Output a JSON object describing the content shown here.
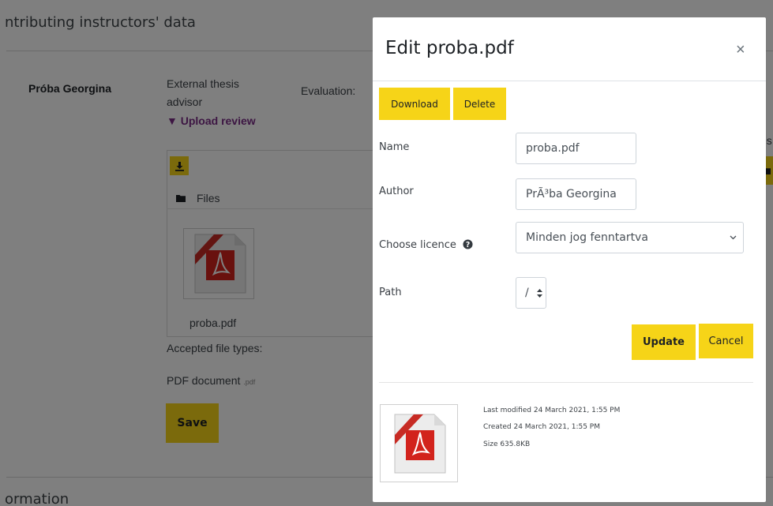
{
  "background": {
    "section_title": "ntributing instructors' data",
    "student_name": "Próba Georgina",
    "role_line1": "External thesis",
    "role_line2": "advisor",
    "upload_review": "▼ Upload review",
    "evaluation_label": "Evaluation:",
    "files_label": "Files",
    "file_name": "proba.pdf",
    "accepted_types_label": "Accepted file types:",
    "pdf_document_label": "PDF document",
    "pdf_ext": ".pdf",
    "save_label": "Save",
    "partial_right_label": "es:",
    "bottom_section_title": "ormation"
  },
  "modal": {
    "title": "Edit proba.pdf",
    "close_glyph": "×",
    "download_label": "Download",
    "delete_label": "Delete",
    "name_label": "Name",
    "name_value": "proba.pdf",
    "author_label": "Author",
    "author_value": "PrÃ³ba Georgina",
    "licence_label": "Choose licence",
    "licence_value": "Minden jog fenntartva",
    "path_label": "Path",
    "path_value": "/",
    "update_label": "Update",
    "cancel_label": "Cancel",
    "last_modified": "Last modified  24 March 2021, 1:55 PM",
    "created": "Created  24 March 2021, 1:55 PM",
    "size": "Size  635.8KB"
  },
  "colors": {
    "accent_yellow": "#f6d418",
    "link_purple": "#7a2d86",
    "pdf_red": "#d2231c"
  },
  "icons": [
    "download-icon",
    "folder-icon",
    "pdf-file-icon",
    "help-icon",
    "chevron-down-icon",
    "sort-icon",
    "close-icon"
  ]
}
